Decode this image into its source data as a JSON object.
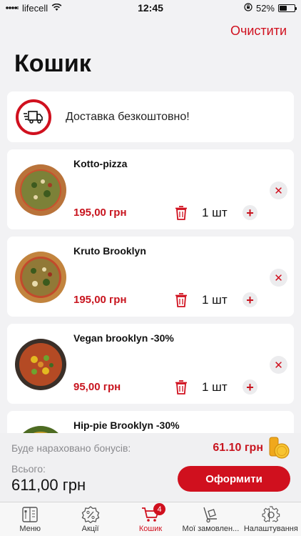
{
  "status_bar": {
    "carrier": "lifecell",
    "time": "12:45",
    "battery": "52%",
    "battery_level": 0.52
  },
  "header": {
    "clear_label": "Очистити",
    "title": "Кошик"
  },
  "delivery": {
    "text": "Доставка безкоштовно!",
    "icon": "truck-icon"
  },
  "items": [
    {
      "name": "Kotto-pizza",
      "price": "195,00 грн",
      "qty": "1 шт"
    },
    {
      "name": "Kruto Brooklyn",
      "price": "195,00 грн",
      "qty": "1 шт"
    },
    {
      "name": "Vegan brooklyn -30%",
      "price": "95,00 грн",
      "qty": "1 шт"
    },
    {
      "name": "Hip-pie Brooklyn -30%",
      "price": "",
      "qty": ""
    }
  ],
  "summary": {
    "bonus_label": "Буде нараховано бонусів:",
    "bonus_value": "61.10 грн",
    "total_label": "Всього:",
    "total_value": "611,00 грн",
    "checkout_label": "Оформити"
  },
  "tabs": [
    {
      "label": "Меню",
      "icon": "menu-book-icon"
    },
    {
      "label": "Акції",
      "icon": "discount-badge-icon"
    },
    {
      "label": "Кошик",
      "icon": "cart-icon",
      "badge": "4"
    },
    {
      "label": "Мої замовлен...",
      "icon": "hand-truck-icon"
    },
    {
      "label": "Налаштування",
      "icon": "gear-icon"
    }
  ],
  "colors": {
    "accent": "#d0101e",
    "price": "#c8151f",
    "background": "#f2f2f4"
  }
}
